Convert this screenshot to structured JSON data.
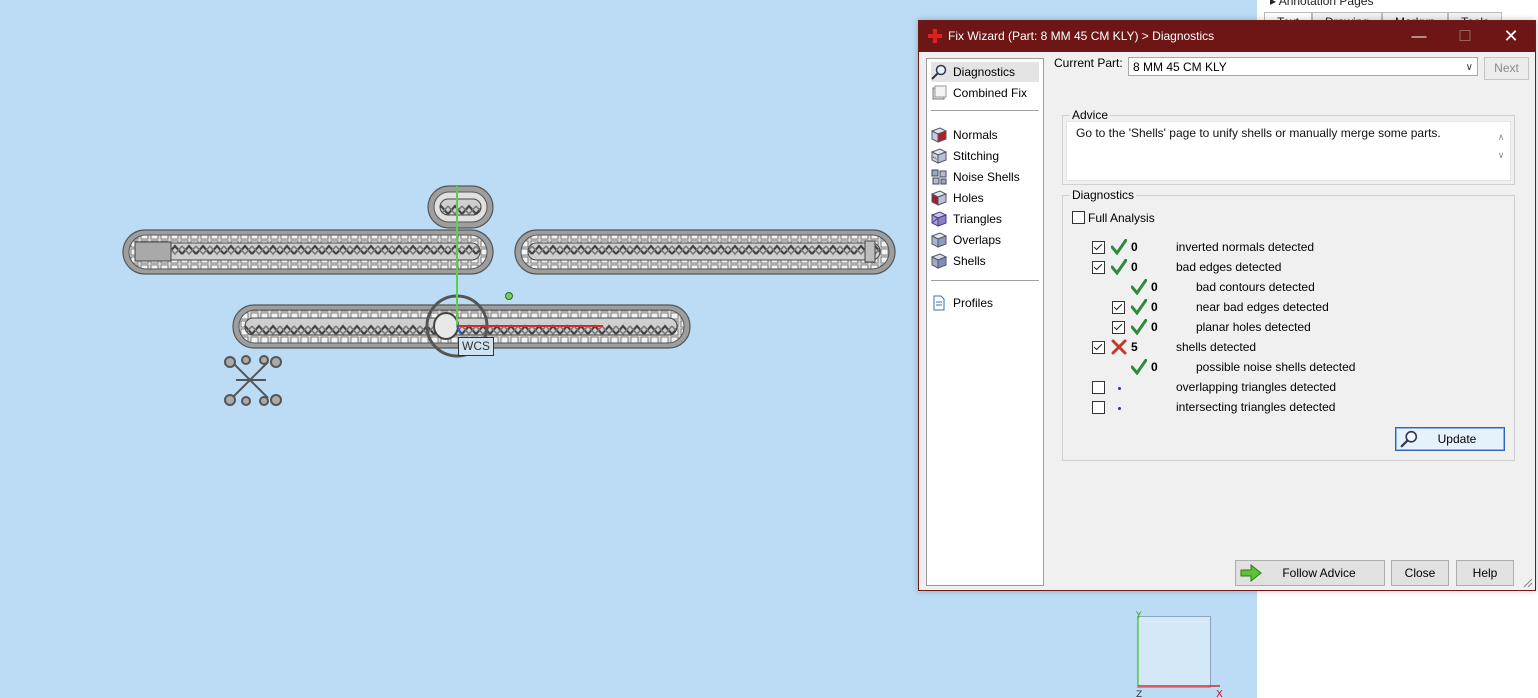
{
  "background_panel": {
    "header": "Annotation Pages",
    "tabs": [
      "Text",
      "Drawing",
      "Markup",
      "Tools"
    ]
  },
  "viewport": {
    "wcs_label": "WCS",
    "mini_axes": {
      "top": "Y",
      "bottom_left": "Z",
      "bottom_right": "X"
    }
  },
  "dialog": {
    "title": "Fix Wizard (Part: 8 MM 45 CM  KLY) > Diagnostics",
    "window_controls": {
      "minimize": "—",
      "maximize": "☐",
      "close": "✕"
    },
    "nav": [
      {
        "label": "Diagnostics",
        "icon": "magnifier-icon",
        "selected": true
      },
      {
        "label": "Combined Fix",
        "icon": "cube-stack-icon"
      },
      {
        "label": "Normals",
        "icon": "normals-cube-icon"
      },
      {
        "label": "Stitching",
        "icon": "stitching-cube-icon"
      },
      {
        "label": "Noise Shells",
        "icon": "noise-shells-icon"
      },
      {
        "label": "Holes",
        "icon": "holes-cube-icon"
      },
      {
        "label": "Triangles",
        "icon": "triangles-cube-icon"
      },
      {
        "label": "Overlaps",
        "icon": "overlaps-cube-icon"
      },
      {
        "label": "Shells",
        "icon": "shells-cube-icon"
      },
      {
        "label": "Profiles",
        "icon": "document-icon"
      }
    ],
    "current_part_label": "Current Part:",
    "current_part_value": "8 MM 45 CM  KLY",
    "next_label": "Next",
    "advice": {
      "title": "Advice",
      "text": "Go to the 'Shells' page to unify shells or manually merge some parts."
    },
    "diagnostics": {
      "title": "Diagnostics",
      "full_analysis_label": "Full Analysis",
      "full_analysis_checked": false,
      "rows": [
        {
          "count": "0",
          "label": "inverted normals detected",
          "status": "ok",
          "checked": true,
          "has_checkbox": true,
          "indent": false
        },
        {
          "count": "0",
          "label": "bad edges detected",
          "status": "ok",
          "checked": true,
          "has_checkbox": true,
          "indent": false
        },
        {
          "count": "0",
          "label": "bad contours detected",
          "status": "ok",
          "checked": false,
          "has_checkbox": false,
          "indent": true
        },
        {
          "count": "0",
          "label": "near bad edges detected",
          "status": "ok",
          "checked": true,
          "has_checkbox": true,
          "indent": true
        },
        {
          "count": "0",
          "label": "planar holes detected",
          "status": "ok",
          "checked": true,
          "has_checkbox": true,
          "indent": true
        },
        {
          "count": "5",
          "label": "shells detected",
          "status": "error",
          "checked": true,
          "has_checkbox": true,
          "indent": false
        },
        {
          "count": "0",
          "label": "possible noise shells detected",
          "status": "ok",
          "checked": false,
          "has_checkbox": false,
          "indent": true
        },
        {
          "count": "",
          "label": "overlapping triangles detected",
          "status": "unknown",
          "checked": false,
          "has_checkbox": true,
          "indent": false
        },
        {
          "count": "",
          "label": "intersecting triangles detected",
          "status": "unknown",
          "checked": false,
          "has_checkbox": true,
          "indent": false
        }
      ]
    },
    "buttons": {
      "update": "Update",
      "follow_advice": "Follow Advice",
      "close": "Close",
      "help": "Help"
    },
    "colors": {
      "titlebar": "#6e1616",
      "ok": "#2e8b3c",
      "error": "#c0392b",
      "viewport_bg": "#bbdcf4"
    }
  }
}
